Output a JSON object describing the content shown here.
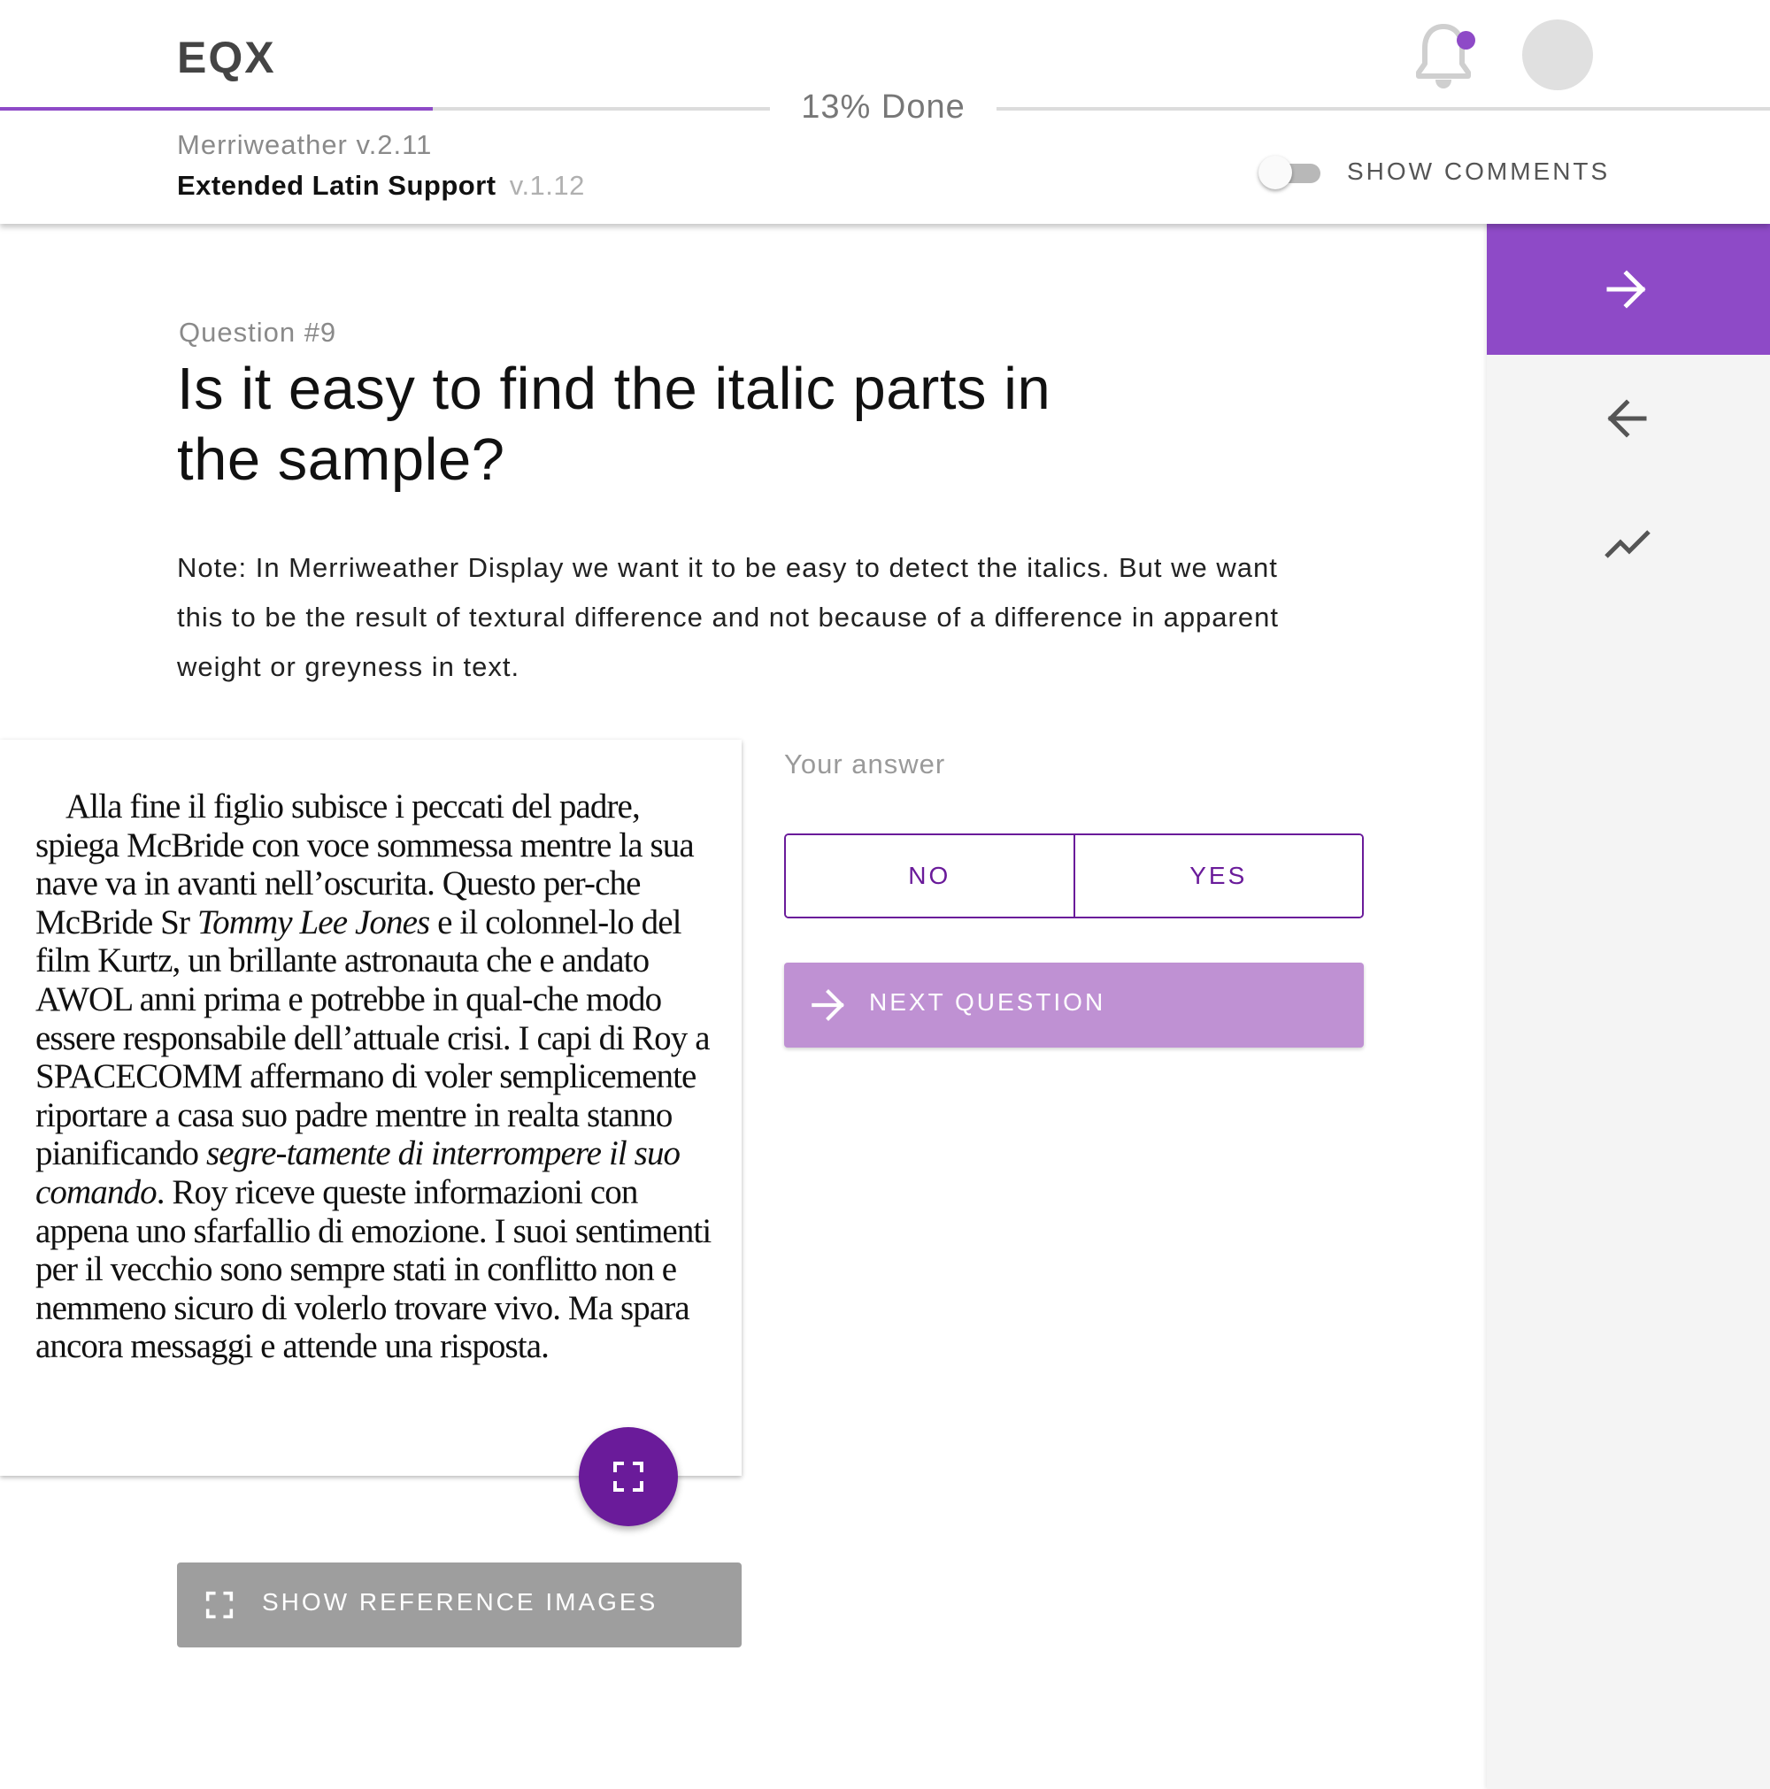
{
  "header": {
    "brand": "EQX",
    "progress_text": "13% Done",
    "progress_percent": 13,
    "font_name": "Merriweather v.2.11",
    "package_name": "Extended Latin Support",
    "package_version": "v.1.12",
    "show_comments_label": "SHOW COMMENTS",
    "show_comments_enabled": false,
    "notification_icon": "bell-icon",
    "notification_dot_color": "#8e4ac7"
  },
  "sidebar": {
    "items": [
      {
        "icon": "arrow-right-icon",
        "active": true
      },
      {
        "icon": "arrow-left-icon",
        "active": false
      },
      {
        "icon": "trending-chart-icon",
        "active": false
      }
    ],
    "accent_color": "#8e4ac7"
  },
  "question": {
    "number_label": "Question #9",
    "title": "Is it easy to find the italic parts in the sample?",
    "note": "Note: In Merriweather Display we want it to be easy to detect the italics. But we want this to be the result of textural difference and not because of a difference in apparent weight or greyness in text."
  },
  "sample": {
    "segments": [
      {
        "text": "Alla fine il figlio subisce i peccati del padre, spiega McBride con voce sommessa mentre la sua nave va in avanti nell’oscurita. Questo per-che McBride Sr ",
        "italic": false
      },
      {
        "text": "Tommy Lee Jones",
        "italic": true
      },
      {
        "text": " e il colonnel-lo del film Kurtz, un brillante astronauta che e andato AWOL anni prima e potrebbe in qual-che modo essere responsabile dell’attuale crisi. I capi di Roy a SPACECOMM affermano di voler semplicemente riportare a casa suo padre mentre in realta stanno pianificando ",
        "italic": false
      },
      {
        "text": "segre-tamente di interrompere il suo comando",
        "italic": true
      },
      {
        "text": ". Roy riceve queste informazioni con appena uno sfarfallio di emozione. I suoi sentimenti per il vecchio sono sempre stati in conflitto  non e nemmeno sicuro di volerlo trovare vivo. Ma spara ancora messaggi e attende una risposta.",
        "italic": false
      }
    ],
    "expand_icon": "fullscreen-icon",
    "reference_button_label": "SHOW REFERENCE IMAGES"
  },
  "answer": {
    "label": "Your answer",
    "options": [
      "NO",
      "YES"
    ],
    "next_button_label": "NEXT QUESTION",
    "accent_color": "#6a1b9a"
  }
}
